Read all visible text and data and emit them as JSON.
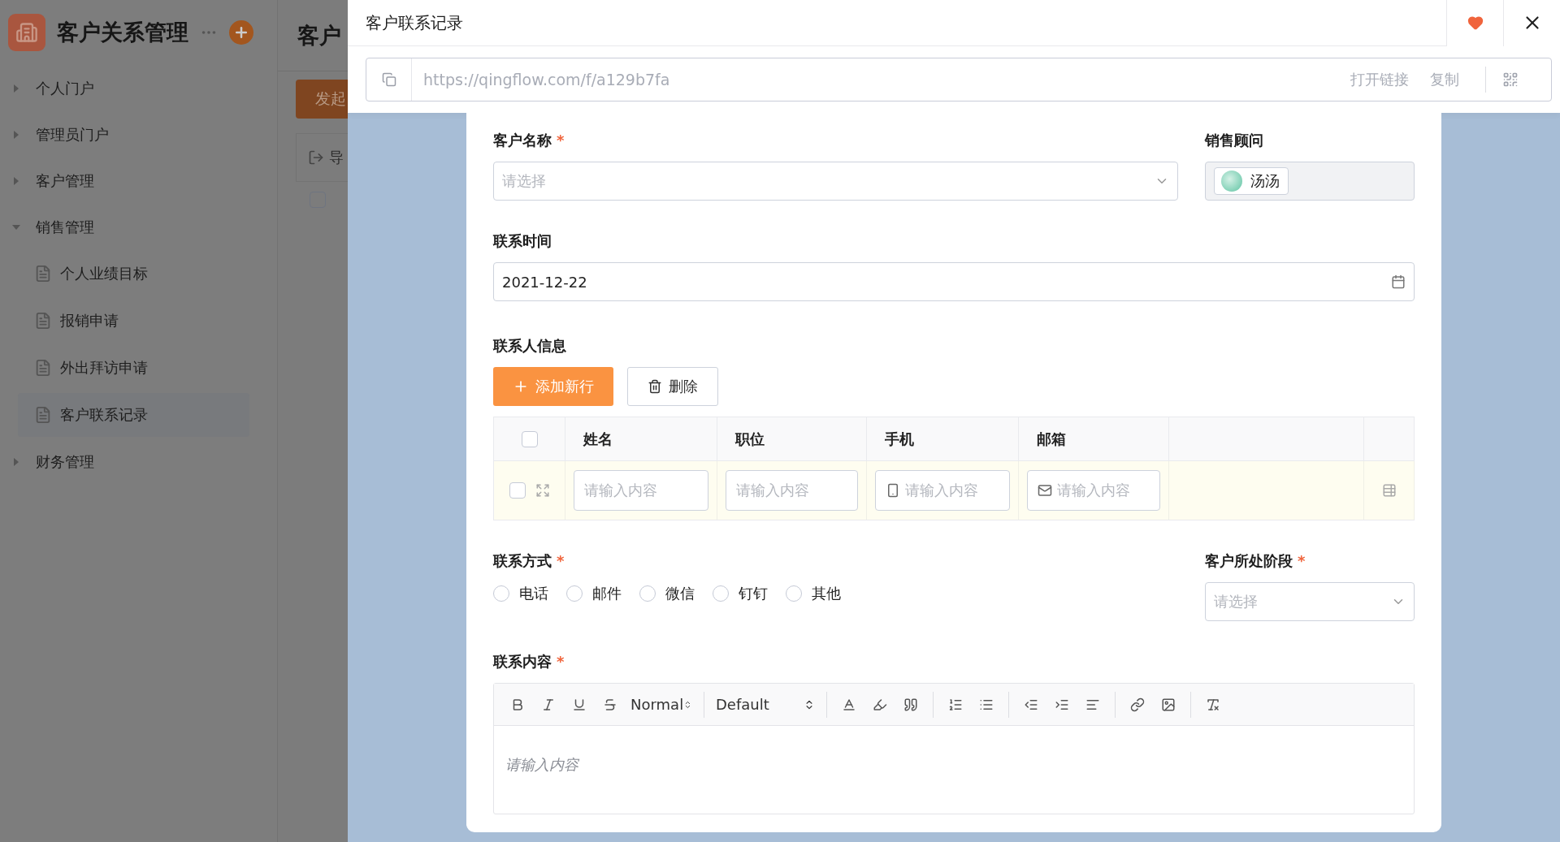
{
  "app": {
    "title": "客户关系管理"
  },
  "sidebar": {
    "items": [
      {
        "label": "个人门户",
        "expanded": false
      },
      {
        "label": "管理员门户",
        "expanded": false
      },
      {
        "label": "客户管理",
        "expanded": false
      },
      {
        "label": "销售管理",
        "expanded": true,
        "children": [
          {
            "label": "个人业绩目标",
            "selected": false
          },
          {
            "label": "报销申请",
            "selected": false
          },
          {
            "label": "外出拜访申请",
            "selected": false
          },
          {
            "label": "客户联系记录",
            "selected": true
          }
        ]
      },
      {
        "label": "财务管理",
        "expanded": false
      }
    ]
  },
  "background_page": {
    "title": "客户",
    "button": "发起",
    "toolbar_label": "导",
    "row_checked": false
  },
  "modal": {
    "title": "客户联系记录",
    "favorited": true,
    "url": "https://qingflow.com/f/a129b7fa",
    "link_actions": [
      "打开链接",
      "复制"
    ]
  },
  "form": {
    "customer_name": {
      "label": "客户名称",
      "required_mark": "*",
      "placeholder": "请选择"
    },
    "sales_advisor": {
      "label": "销售顾问",
      "value": "汤汤"
    },
    "contact_time": {
      "label": "联系时间",
      "value": "2021-12-22"
    },
    "contacts": {
      "label": "联系人信息",
      "add_button": "添加新行",
      "delete_button": "删除",
      "select_all_checked": false,
      "columns": [
        "姓名",
        "职位",
        "手机",
        "邮箱"
      ],
      "rows": [
        {
          "checked": false,
          "cells": [
            {
              "kind": "text",
              "placeholder": "请输入内容"
            },
            {
              "kind": "text",
              "placeholder": "请输入内容"
            },
            {
              "kind": "phone",
              "placeholder": "请输入内容"
            },
            {
              "kind": "email",
              "placeholder": "请输入内容"
            }
          ]
        }
      ]
    },
    "contact_method": {
      "label": "联系方式",
      "required_mark": "*",
      "options": [
        {
          "label": "电话",
          "selected": false
        },
        {
          "label": "邮件",
          "selected": false
        },
        {
          "label": "微信",
          "selected": false
        },
        {
          "label": "钉钉",
          "selected": false
        },
        {
          "label": "其他",
          "selected": false
        }
      ]
    },
    "stage": {
      "label": "客户所处阶段",
      "required_mark": "*",
      "placeholder": "请选择"
    },
    "content": {
      "label": "联系内容",
      "required_mark": "*",
      "heading_select": "Normal",
      "font_select": "Default",
      "placeholder": "请输入内容"
    }
  }
}
